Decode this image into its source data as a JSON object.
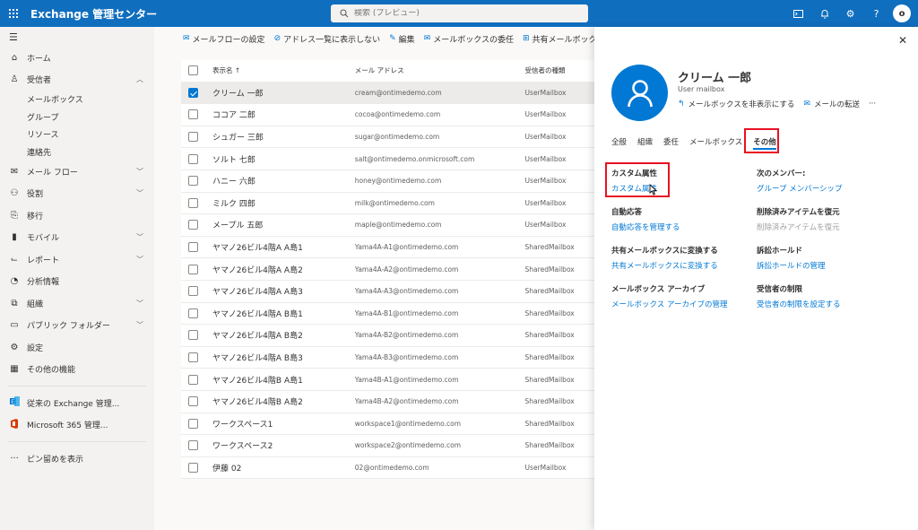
{
  "app": {
    "title": "Exchange 管理センター",
    "search_placeholder": "検索 (プレビュー)",
    "user_initial": "o"
  },
  "nav": {
    "items": [
      {
        "label": "ホーム",
        "icon": "home-icon",
        "glyph": "⌂"
      },
      {
        "label": "受信者",
        "icon": "person-icon",
        "glyph": "♙",
        "expanded": true
      },
      {
        "label": "メール フロー",
        "icon": "mail-icon",
        "glyph": "✉"
      },
      {
        "label": "役割",
        "icon": "roles-icon",
        "glyph": "⚇"
      },
      {
        "label": "移行",
        "icon": "migration-icon",
        "glyph": "⎘"
      },
      {
        "label": "モバイル",
        "icon": "mobile-icon",
        "glyph": "▮"
      },
      {
        "label": "レポート",
        "icon": "reports-icon",
        "glyph": "⌙"
      },
      {
        "label": "分析情報",
        "icon": "insights-icon",
        "glyph": "◔"
      },
      {
        "label": "組織",
        "icon": "organization-icon",
        "glyph": "⧉"
      },
      {
        "label": "パブリック フォルダー",
        "icon": "folder-icon",
        "glyph": "▭"
      },
      {
        "label": "設定",
        "icon": "settings-icon",
        "glyph": "⚙"
      },
      {
        "label": "その他の機能",
        "icon": "more-features-icon",
        "glyph": "▦"
      }
    ],
    "sub_items": [
      "メールボックス",
      "グループ",
      "リソース",
      "連絡先"
    ],
    "bottom_items": [
      {
        "label": "従来の Exchange 管理...",
        "icon": "exchange-icon"
      },
      {
        "label": "Microsoft 365 管理...",
        "icon": "office-icon"
      }
    ],
    "show_pinned": "ピン留めを表示"
  },
  "commands": [
    {
      "label": "メールフローの設定",
      "icon": "mail-settings-icon",
      "glyph": "✉"
    },
    {
      "label": "アドレス一覧に表示しない",
      "icon": "hide-address-icon",
      "glyph": "⊘"
    },
    {
      "label": "編集",
      "icon": "edit-icon",
      "glyph": "✎"
    },
    {
      "label": "メールボックスの委任",
      "icon": "delegate-icon",
      "glyph": "✉"
    },
    {
      "label": "共有メールボックスに変換する",
      "icon": "convert-icon",
      "glyph": "⊞"
    },
    {
      "label": "…",
      "icon": "more-icon",
      "glyph": ""
    }
  ],
  "table": {
    "headers": {
      "name": "表示名 ↑",
      "mail": "メール アドレス",
      "type": "受信者の種類"
    },
    "rows": [
      {
        "name": "クリーム 一郎",
        "mail": "cream@ontimedemo.com",
        "type": "UserMailbox",
        "selected": true
      },
      {
        "name": "ココア 二郎",
        "mail": "cocoa@ontimedemo.com",
        "type": "UserMailbox"
      },
      {
        "name": "シュガー 三郎",
        "mail": "sugar@ontimedemo.com",
        "type": "UserMailbox"
      },
      {
        "name": "ソルト 七郎",
        "mail": "salt@ontimedemo.onmicrosoft.com",
        "type": "UserMailbox"
      },
      {
        "name": "ハニー 六郎",
        "mail": "honey@ontimedemo.com",
        "type": "UserMailbox"
      },
      {
        "name": "ミルク 四郎",
        "mail": "milk@ontimedemo.com",
        "type": "UserMailbox"
      },
      {
        "name": "メープル 五郎",
        "mail": "maple@ontimedemo.com",
        "type": "UserMailbox"
      },
      {
        "name": "ヤマノ26ビル4階A A島1",
        "mail": "Yama4A-A1@ontimedemo.com",
        "type": "SharedMailbox"
      },
      {
        "name": "ヤマノ26ビル4階A A島2",
        "mail": "Yama4A-A2@ontimedemo.com",
        "type": "SharedMailbox"
      },
      {
        "name": "ヤマノ26ビル4階A A島3",
        "mail": "Yama4A-A3@ontimedemo.com",
        "type": "SharedMailbox"
      },
      {
        "name": "ヤマノ26ビル4階A B島1",
        "mail": "Yama4A-B1@ontimedemo.com",
        "type": "SharedMailbox"
      },
      {
        "name": "ヤマノ26ビル4階A B島2",
        "mail": "Yama4A-B2@ontimedemo.com",
        "type": "SharedMailbox"
      },
      {
        "name": "ヤマノ26ビル4階A B島3",
        "mail": "Yama4A-B3@ontimedemo.com",
        "type": "SharedMailbox"
      },
      {
        "name": "ヤマノ26ビル4階B A島1",
        "mail": "Yama4B-A1@ontimedemo.com",
        "type": "SharedMailbox"
      },
      {
        "name": "ヤマノ26ビル4階B A島2",
        "mail": "Yama4B-A2@ontimedemo.com",
        "type": "SharedMailbox"
      },
      {
        "name": "ワークスペース1",
        "mail": "workspace1@ontimedemo.com",
        "type": "SharedMailbox"
      },
      {
        "name": "ワークスペース2",
        "mail": "workspace2@ontimedemo.com",
        "type": "SharedMailbox"
      },
      {
        "name": "伊藤 02",
        "mail": "02@ontimedemo.com",
        "type": "UserMailbox"
      }
    ]
  },
  "panel": {
    "name": "クリーム 一郎",
    "subtitle": "User mailbox",
    "actions": [
      {
        "label": "メールボックスを非表示にする",
        "icon": "hide-mailbox-icon",
        "glyph": "↰"
      },
      {
        "label": "メールの転送",
        "icon": "forward-mail-icon",
        "glyph": "✉"
      }
    ],
    "more": "···",
    "tabs": [
      "全般",
      "組織",
      "委任",
      "メールボックス",
      "その他"
    ],
    "active_tab": 4,
    "sections": [
      {
        "title": "カスタム属性",
        "link": "カスタム属性"
      },
      {
        "title": "次のメンバー:",
        "link": "グループ メンバーシップ"
      },
      {
        "title": "自動応答",
        "link": "自動応答を管理する"
      },
      {
        "title": "削除済みアイテムを復元",
        "link": "削除済みアイテムを復元",
        "disabled": true
      },
      {
        "title": "共有メールボックスに変換する",
        "link": "共有メールボックスに変換する"
      },
      {
        "title": "訴訟ホールド",
        "link": "訴訟ホールドの管理"
      },
      {
        "title": "メールボックス アーカイブ",
        "link": "メールボックス アーカイブの管理"
      },
      {
        "title": "受信者の制限",
        "link": "受信者の制限を設定する"
      }
    ]
  },
  "colors": {
    "accent": "#0078d4",
    "topbar": "#106ebe",
    "highlight": "#e81123"
  }
}
